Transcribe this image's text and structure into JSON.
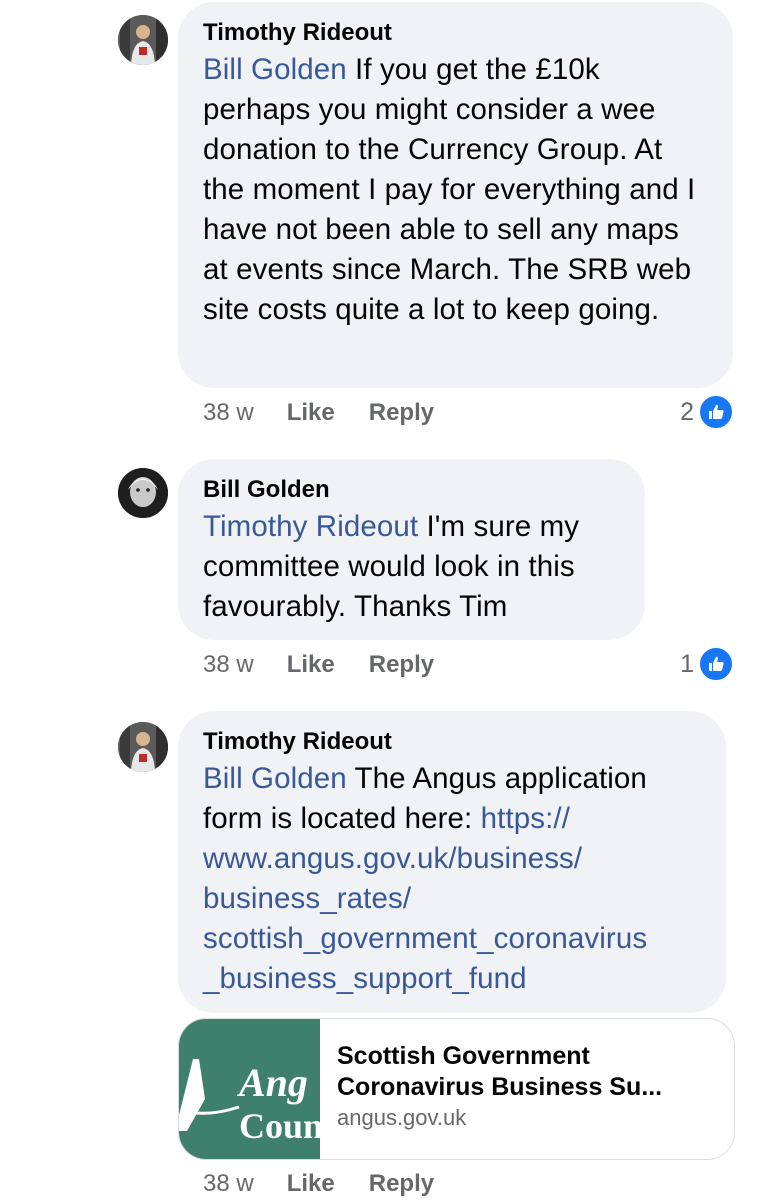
{
  "comments": [
    {
      "author": "Timothy Rideout",
      "mention": "Bill Golden",
      "text": " If you get the £10k perhaps you might consider a wee donation to the Currency Group. At the moment I pay for everything and I have not been able to sell any maps at events since March. The SRB web site costs quite a lot to keep going.",
      "time": "38 w",
      "like_label": "Like",
      "reply_label": "Reply",
      "reaction_count": "2"
    },
    {
      "author": "Bill Golden",
      "mention": "Timothy Rideout",
      "text": " I'm sure my committee would look in this favourably. Thanks Tim",
      "time": "38 w",
      "like_label": "Like",
      "reply_label": "Reply",
      "reaction_count": "1"
    },
    {
      "author": "Timothy Rideout",
      "mention": "Bill Golden",
      "text": " The Angus application form is located here: ",
      "link_lines": [
        "https://",
        "www.angus.gov.uk/business/",
        "business_rates/",
        "scottish_government_coronavirus",
        "_business_support_fund"
      ],
      "preview": {
        "image_text_1": "Ang",
        "image_text_2": "Coun",
        "image_letter": "A",
        "title_1": "Scottish Government",
        "title_2": "Coronavirus Business Su...",
        "domain": "angus.gov.uk"
      },
      "time": "38 w",
      "like_label": "Like",
      "reply_label": "Reply"
    }
  ],
  "colors": {
    "link": "#385898",
    "bubble": "#f0f2f5",
    "like_blue": "#1877f2",
    "meta": "#65676b"
  },
  "icons": [
    "avatar-timothy",
    "avatar-bill",
    "like-thumb-icon"
  ]
}
